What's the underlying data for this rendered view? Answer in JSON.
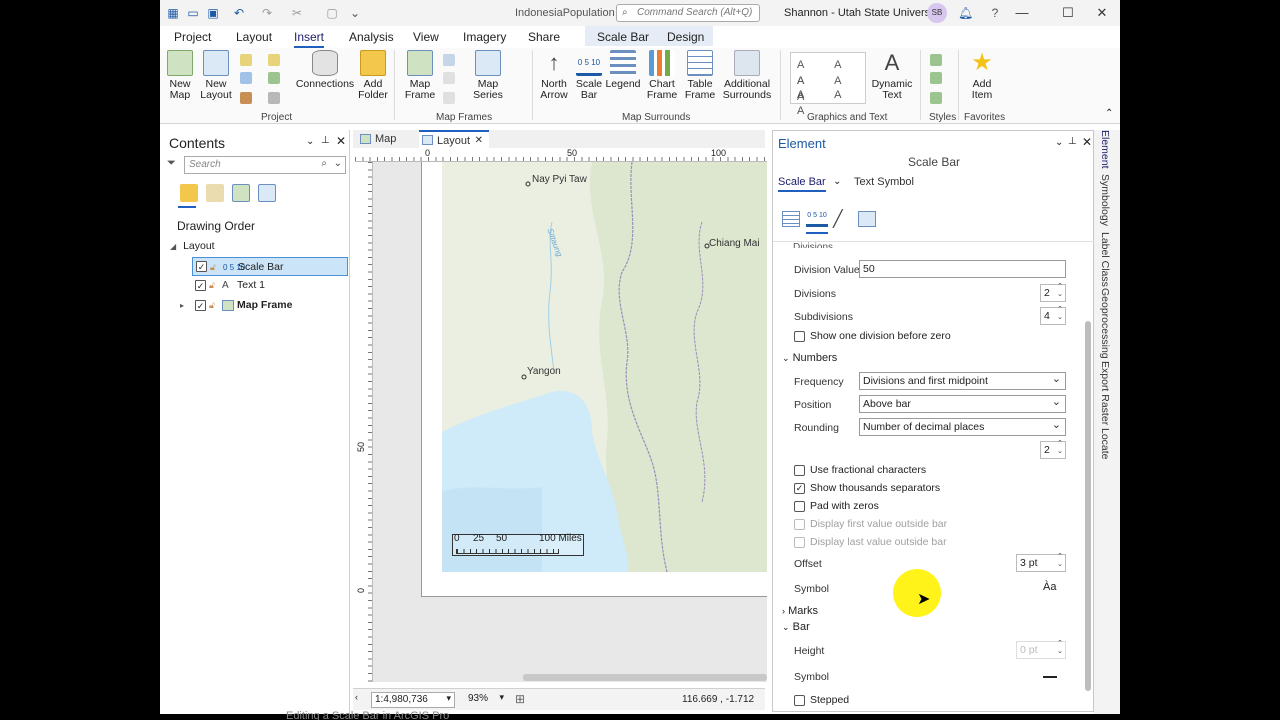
{
  "titlebar": {
    "project_name": "IndonesiaPopulation",
    "search_placeholder": "Command Search (Alt+Q)",
    "user": "Shannon - Utah State University",
    "avatar_initials": "SB"
  },
  "ribbon_tabs": [
    "Project",
    "Layout",
    "Insert",
    "Analysis",
    "View",
    "Imagery",
    "Share",
    "Scale Bar",
    "Design"
  ],
  "active_tab": "Insert",
  "ribbon": {
    "project_group": "Project",
    "new_map": "New\nMap",
    "new_layout": "New\nLayout",
    "connections": "Connections",
    "add_folder": "Add\nFolder",
    "map_frames_group": "Map Frames",
    "map_frame": "Map\nFrame",
    "map_series": "Map\nSeries",
    "map_surrounds_group": "Map Surrounds",
    "north_arrow": "North\nArrow",
    "scale_bar": "Scale\nBar",
    "legend": "Legend",
    "chart_frame": "Chart\nFrame",
    "table_frame": "Table\nFrame",
    "additional_surrounds": "Additional\nSurrounds",
    "graphics_group": "Graphics and Text",
    "dynamic_text": "Dynamic\nText",
    "styles_group": "Styles",
    "favorites_group": "Favorites",
    "add_item": "Add\nItem"
  },
  "contents": {
    "title": "Contents",
    "search_placeholder": "Search",
    "drawing_order": "Drawing Order",
    "root": "Layout",
    "items": [
      {
        "label": "Scale Bar",
        "checked": true,
        "selected": true
      },
      {
        "label": "Text 1",
        "checked": true,
        "selected": false
      },
      {
        "label": "Map Frame",
        "checked": true,
        "selected": false
      }
    ]
  },
  "view": {
    "tabs": [
      "Map",
      "Layout"
    ],
    "active_view": "Layout",
    "ruler_top": [
      "0",
      "50",
      "100"
    ],
    "ruler_left": [
      "50",
      "0"
    ],
    "map_labels": {
      "naypyitaw": "Nay Pyi Taw",
      "chiangmai": "Chiang Mai",
      "yangon": "Yangon",
      "sittaung": "Sittaung"
    },
    "scalebar_labels": [
      "0",
      "25",
      "50",
      "100 Miles"
    ],
    "scale": "1:4,980,736",
    "zoom": "93%",
    "coords": "116.669 , -1.712"
  },
  "element": {
    "title": "Element",
    "subtitle": "Scale Bar",
    "subtab_scalebar": "Scale Bar",
    "subtab_textsymbol": "Text Symbol",
    "divisions_header": "Divisions",
    "division_value_label": "Division Value",
    "division_value": "50",
    "divisions_label": "Divisions",
    "divisions": "2",
    "subdivisions_label": "Subdivisions",
    "subdivisions": "4",
    "show_one_division": "Show one division before zero",
    "numbers_header": "Numbers",
    "frequency_label": "Frequency",
    "frequency": "Divisions and first midpoint",
    "position_label": "Position",
    "position": "Above bar",
    "rounding_label": "Rounding",
    "rounding": "Number of decimal places",
    "decimal_places": "2",
    "use_fractional": "Use fractional characters",
    "show_thousands": "Show thousands separators",
    "pad_zeros": "Pad with zeros",
    "display_first": "Display first value outside bar",
    "display_last": "Display last value outside bar",
    "offset_label": "Offset",
    "offset": "3 pt",
    "symbol_label": "Symbol",
    "symbol_glyph": "Àa",
    "marks_header": "Marks",
    "bar_header": "Bar",
    "height_label": "Height",
    "height": "0 pt",
    "bar_symbol_label": "Symbol",
    "stepped": "Stepped"
  },
  "side_tabs": [
    "Element",
    "Symbology",
    "Label Class",
    "Geoprocessing",
    "Export Raster",
    "Locate"
  ],
  "caption": "Editing a Scale Bar in ArcGIS Pro"
}
